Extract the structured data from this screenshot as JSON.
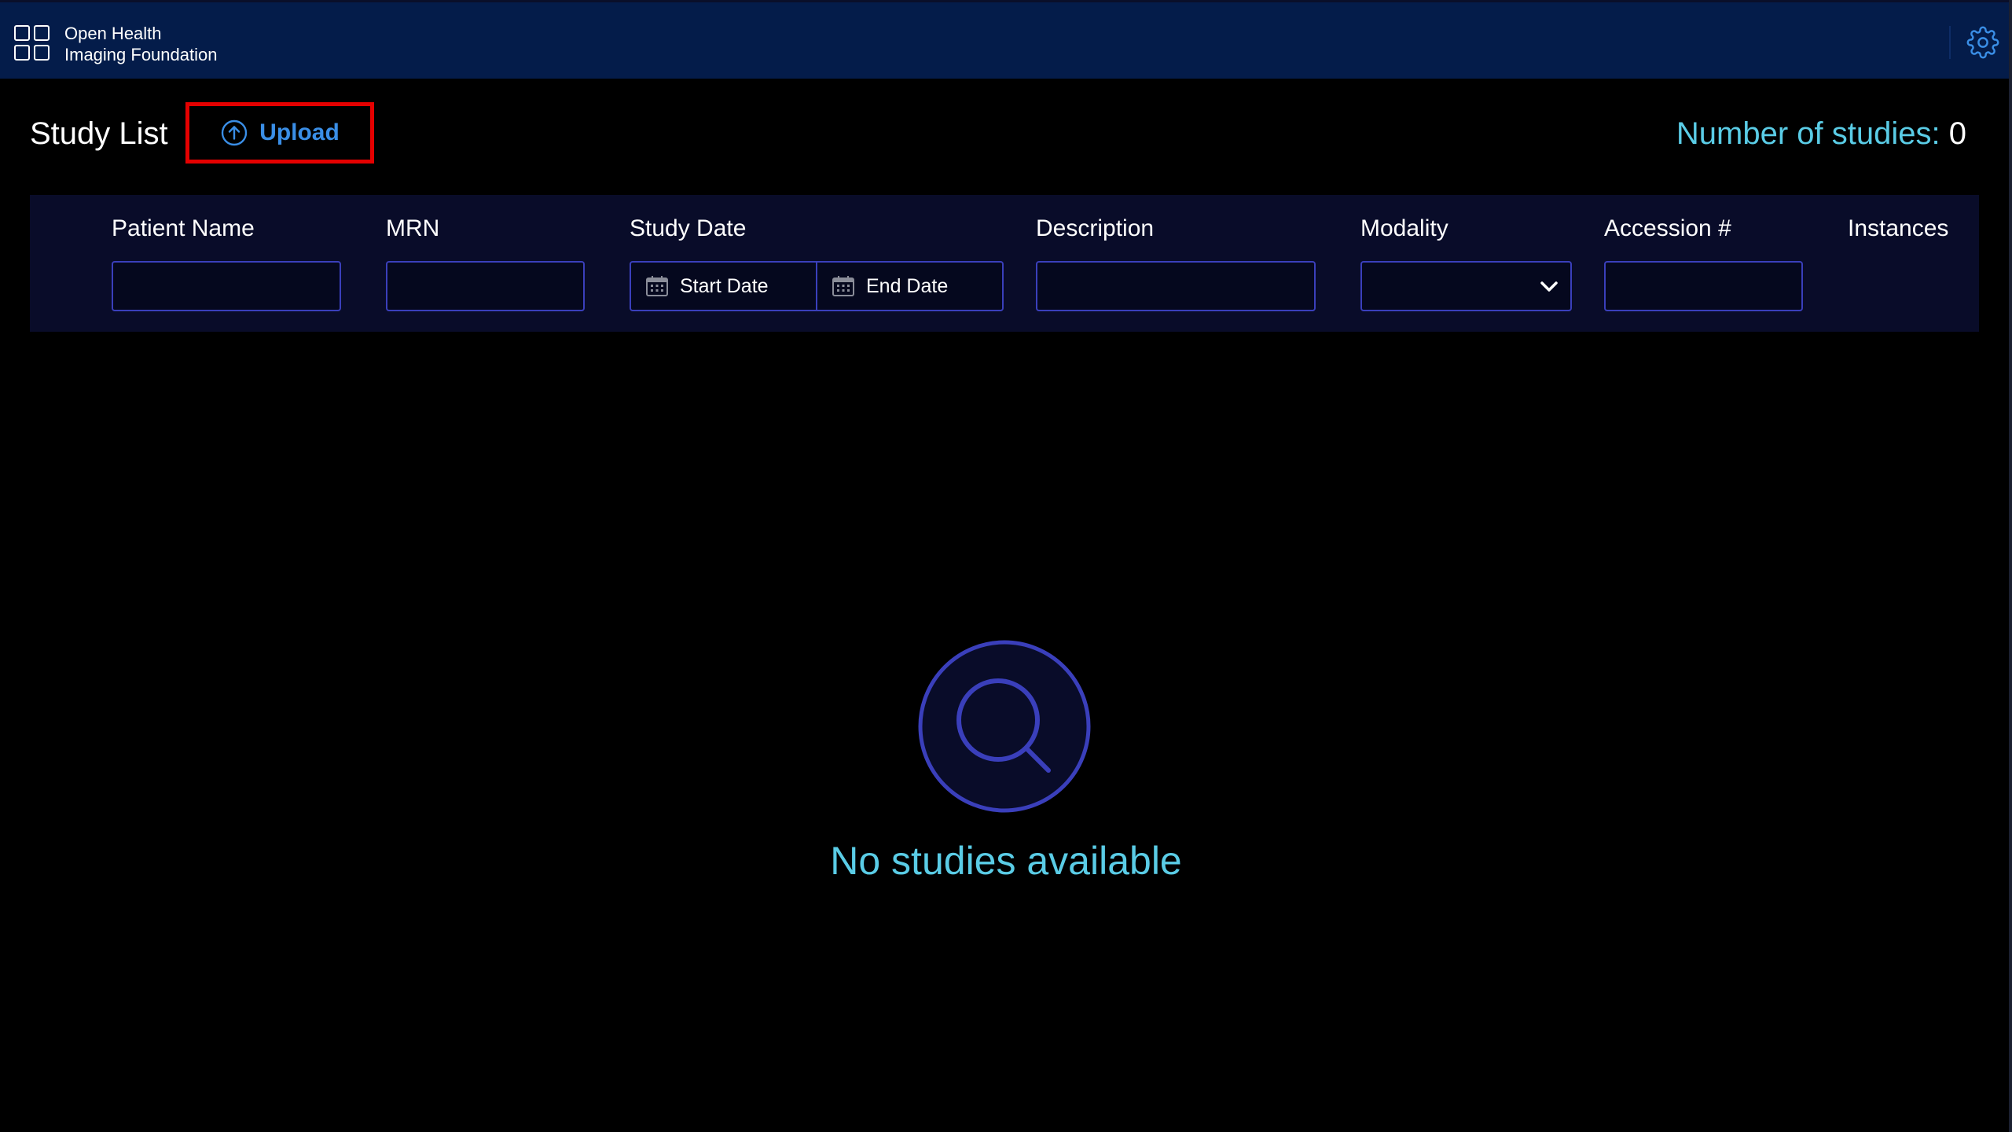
{
  "header": {
    "brand_line1": "Open Health",
    "brand_line2": "Imaging Foundation",
    "settings_icon": "gear-icon"
  },
  "toolbar": {
    "title": "Study List",
    "upload_label": "Upload",
    "upload_icon": "upload-circle-arrow-icon",
    "count_label": "Number of studies:",
    "count_value": "0"
  },
  "filters": {
    "patient_name_label": "Patient Name",
    "mrn_label": "MRN",
    "study_date_label": "Study Date",
    "start_date_placeholder": "Start Date",
    "end_date_placeholder": "End Date",
    "description_label": "Description",
    "modality_label": "Modality",
    "accession_label": "Accession #",
    "instances_label": "Instances"
  },
  "empty_state": {
    "message": "No studies available",
    "icon": "magnifier-icon"
  },
  "colors": {
    "header_bg": "#041c4a",
    "filterbar_bg": "#090c29",
    "accent_cyan": "#5acce6",
    "upload_blue": "#3a8ee6",
    "highlight_red": "#e40000",
    "input_border": "#3a3fbb"
  }
}
